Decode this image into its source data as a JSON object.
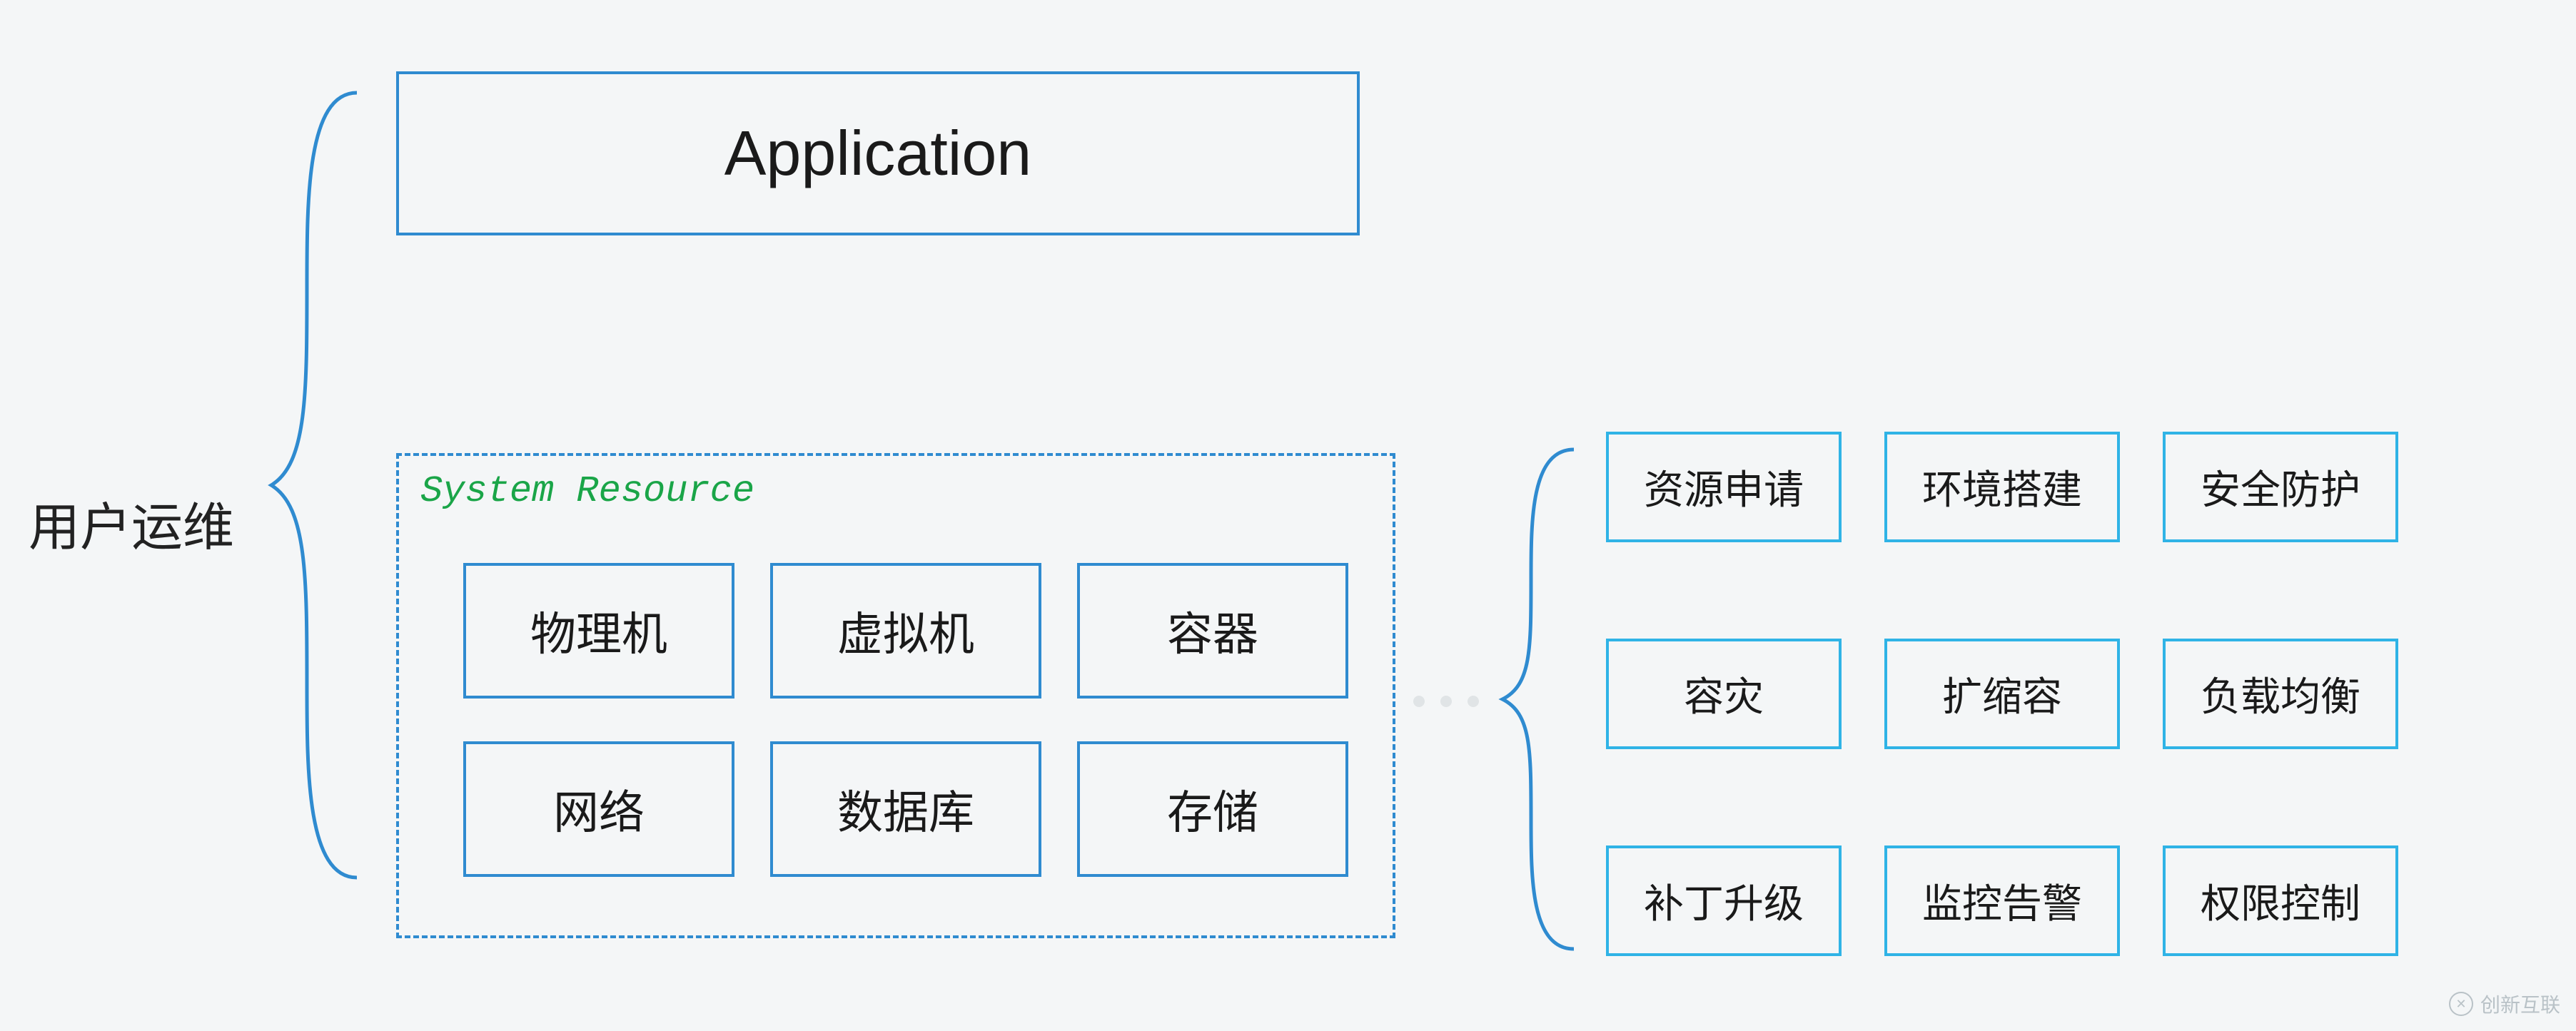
{
  "label": "用户运维",
  "application": {
    "title": "Application"
  },
  "system_resource": {
    "title": "System Resource",
    "items": [
      "物理机",
      "虚拟机",
      "容器",
      "网络",
      "数据库",
      "存储"
    ]
  },
  "ops_tasks": {
    "rows": [
      [
        "资源申请",
        "环境搭建",
        "安全防护"
      ],
      [
        "容灾",
        "扩缩容",
        "负载均衡"
      ],
      [
        "补丁升级",
        "监控告警",
        "权限控制"
      ]
    ]
  },
  "watermark": "创新互联"
}
